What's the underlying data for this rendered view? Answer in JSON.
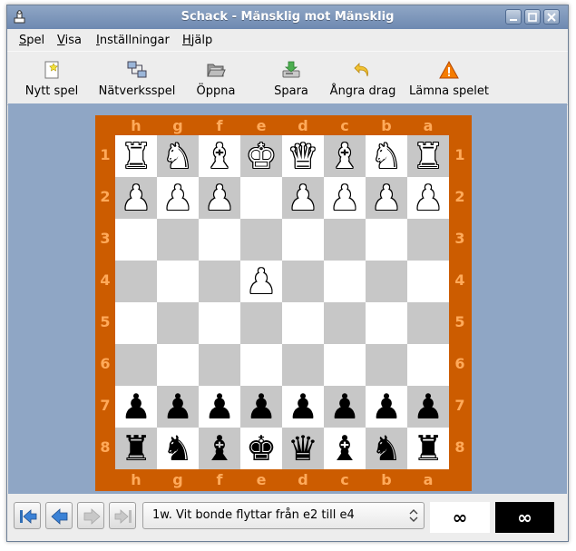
{
  "window": {
    "title": "Schack - Mänsklig mot Mänsklig"
  },
  "menu": [
    {
      "mnemonic": "S",
      "rest": "pel"
    },
    {
      "mnemonic": "V",
      "rest": "isa"
    },
    {
      "mnemonic": "I",
      "rest": "nställningar"
    },
    {
      "mnemonic": "H",
      "rest": "jälp"
    }
  ],
  "toolbar": {
    "new_game": "Nytt spel",
    "network_game": "Nätverksspel",
    "open": "Öppna",
    "save": "Spara",
    "undo": "Ångra drag",
    "resign": "Lämna spelet"
  },
  "board": {
    "files": [
      "h",
      "g",
      "f",
      "e",
      "d",
      "c",
      "b",
      "a"
    ],
    "ranks": [
      "1",
      "2",
      "3",
      "4",
      "5",
      "6",
      "7",
      "8"
    ],
    "rows": [
      [
        "wR",
        "wN",
        "wB",
        "wK",
        "wQ",
        "wB",
        "wN",
        "wR"
      ],
      [
        "wP",
        "wP",
        "wP",
        "",
        "wP",
        "wP",
        "wP",
        "wP"
      ],
      [
        "",
        "",
        "",
        "",
        "",
        "",
        "",
        ""
      ],
      [
        "",
        "",
        "",
        "wP",
        "",
        "",
        "",
        ""
      ],
      [
        "",
        "",
        "",
        "",
        "",
        "",
        "",
        ""
      ],
      [
        "",
        "",
        "",
        "",
        "",
        "",
        "",
        ""
      ],
      [
        "bP",
        "bP",
        "bP",
        "bP",
        "bP",
        "bP",
        "bP",
        "bP"
      ],
      [
        "bR",
        "bN",
        "bB",
        "bK",
        "bQ",
        "bB",
        "bN",
        "bR"
      ]
    ],
    "colors": {
      "frame": "#cc5c00",
      "coordinates": "#ffaa5a",
      "light": "#ffffff",
      "dark": "#c7c7c7"
    }
  },
  "status": {
    "move_text": "1w. Vit bonde flyttar från e2 till e4",
    "white_clock": "∞",
    "black_clock": "∞"
  },
  "icons": {
    "first": "go-first-icon",
    "previous": "go-previous-icon",
    "next": "go-next-icon",
    "last": "go-last-icon"
  }
}
